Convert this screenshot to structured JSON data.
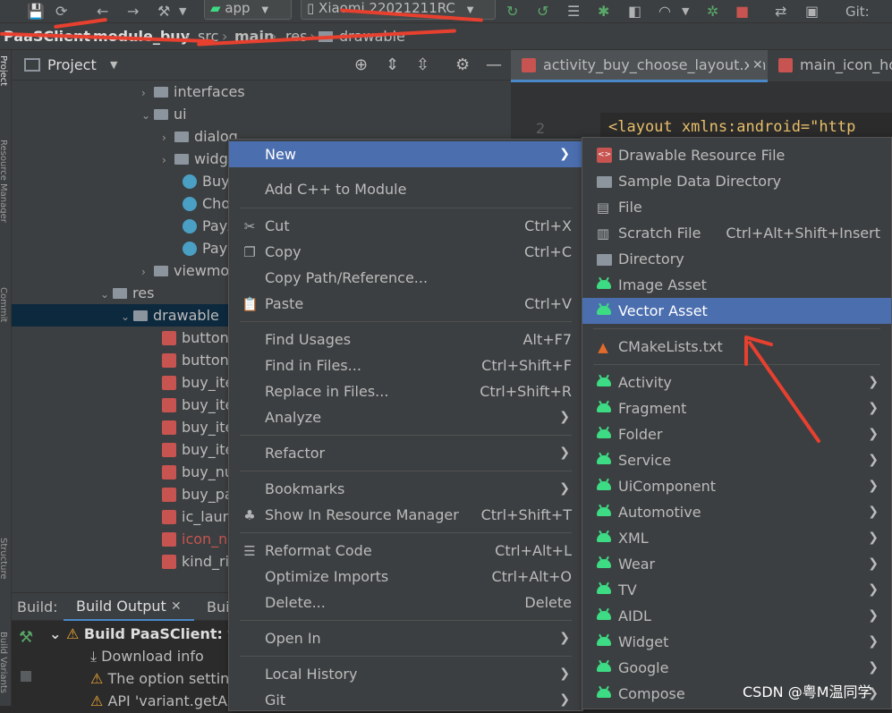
{
  "toolbar": {
    "run_config": "app",
    "device": "Xiaomi 22021211RC",
    "git_label": "Git:"
  },
  "breadcrumb": {
    "items": [
      "PaaSClient",
      "module_buy",
      "src",
      "main",
      "res",
      "drawable"
    ]
  },
  "left_strip": {
    "project": "Project",
    "resource_manager": "Resource Manager",
    "commit": "Commit",
    "structure": "Structure",
    "build_variants": "Build Variants"
  },
  "project_panel": {
    "title": "Project"
  },
  "tree": {
    "rows": [
      {
        "label": "interfaces"
      },
      {
        "label": "ui"
      },
      {
        "label": "dialog"
      },
      {
        "label": "widget"
      },
      {
        "label": "BuyActivity"
      },
      {
        "label": "ChooseActivity"
      },
      {
        "label": "PayActivity"
      },
      {
        "label": "PayResultActivity"
      },
      {
        "label": "viewmodel"
      },
      {
        "label": "res"
      },
      {
        "label": "drawable"
      },
      {
        "label": "button_bg"
      },
      {
        "label": "button_bg_gray"
      },
      {
        "label": "buy_item_bg"
      },
      {
        "label": "buy_item_bg_sel"
      },
      {
        "label": "buy_item_title"
      },
      {
        "label": "buy_item_title_sel"
      },
      {
        "label": "buy_num_bg"
      },
      {
        "label": "buy_pay_bg"
      },
      {
        "label": "ic_launcher_background"
      },
      {
        "label": "icon_no"
      },
      {
        "label": "kind_right"
      }
    ]
  },
  "editor": {
    "tab1": "activity_buy_choose_layout.xml",
    "tab2": "main_icon_home.xml",
    "line_number": "2",
    "code": "<layout xmlns:android=\"http"
  },
  "build_panel": {
    "label": "Build:",
    "tab_output": "Build Output",
    "tab_sync": "Build",
    "rows": [
      {
        "text": "Build PaaSClient: failed"
      },
      {
        "text": "Download info"
      },
      {
        "text": "The option setting"
      },
      {
        "text": "API 'variant.getAssemble"
      }
    ]
  },
  "context_menu": {
    "items": [
      {
        "label": "New",
        "shortcut": ""
      },
      {
        "label": "Add C++ to Module",
        "shortcut": ""
      },
      {
        "label": "Cut",
        "shortcut": "Ctrl+X"
      },
      {
        "label": "Copy",
        "shortcut": "Ctrl+C"
      },
      {
        "label": "Copy Path/Reference...",
        "shortcut": ""
      },
      {
        "label": "Paste",
        "shortcut": "Ctrl+V"
      },
      {
        "label": "Find Usages",
        "shortcut": "Alt+F7"
      },
      {
        "label": "Find in Files...",
        "shortcut": "Ctrl+Shift+F"
      },
      {
        "label": "Replace in Files...",
        "shortcut": "Ctrl+Shift+R"
      },
      {
        "label": "Analyze",
        "shortcut": ""
      },
      {
        "label": "Refactor",
        "shortcut": ""
      },
      {
        "label": "Bookmarks",
        "shortcut": ""
      },
      {
        "label": "Show In Resource Manager",
        "shortcut": "Ctrl+Shift+T"
      },
      {
        "label": "Reformat Code",
        "shortcut": "Ctrl+Alt+L"
      },
      {
        "label": "Optimize Imports",
        "shortcut": "Ctrl+Alt+O"
      },
      {
        "label": "Delete...",
        "shortcut": "Delete"
      },
      {
        "label": "Open In",
        "shortcut": ""
      },
      {
        "label": "Local History",
        "shortcut": ""
      },
      {
        "label": "Git",
        "shortcut": ""
      }
    ]
  },
  "submenu": {
    "items": [
      {
        "label": "Drawable Resource File",
        "shortcut": ""
      },
      {
        "label": "Sample Data Directory",
        "shortcut": ""
      },
      {
        "label": "File",
        "shortcut": ""
      },
      {
        "label": "Scratch File",
        "shortcut": "Ctrl+Alt+Shift+Insert"
      },
      {
        "label": "Directory",
        "shortcut": ""
      },
      {
        "label": "Image Asset",
        "shortcut": ""
      },
      {
        "label": "Vector Asset",
        "shortcut": ""
      },
      {
        "label": "CMakeLists.txt",
        "shortcut": ""
      },
      {
        "label": "Activity",
        "shortcut": ""
      },
      {
        "label": "Fragment",
        "shortcut": ""
      },
      {
        "label": "Folder",
        "shortcut": ""
      },
      {
        "label": "Service",
        "shortcut": ""
      },
      {
        "label": "UiComponent",
        "shortcut": ""
      },
      {
        "label": "Automotive",
        "shortcut": ""
      },
      {
        "label": "XML",
        "shortcut": ""
      },
      {
        "label": "Wear",
        "shortcut": ""
      },
      {
        "label": "TV",
        "shortcut": ""
      },
      {
        "label": "AIDL",
        "shortcut": ""
      },
      {
        "label": "Widget",
        "shortcut": ""
      },
      {
        "label": "Google",
        "shortcut": ""
      },
      {
        "label": "Compose",
        "shortcut": ""
      }
    ]
  },
  "watermark": "CSDN @粤M温同学",
  "colors": {
    "highlight": "#4b6eaf",
    "annotation_red": "#e8402f",
    "android_green": "#3ddc84"
  }
}
